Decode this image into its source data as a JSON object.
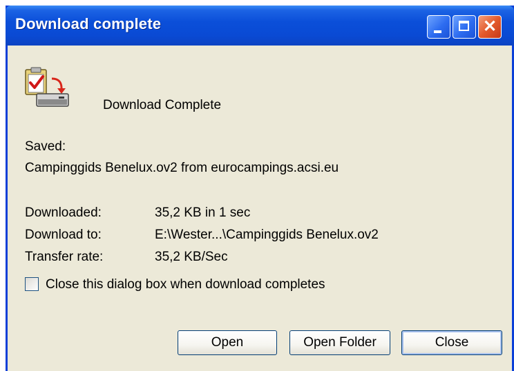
{
  "window": {
    "title": "Download complete",
    "controls": {
      "minimize": "minimize",
      "maximize": "maximize",
      "close": "close"
    }
  },
  "dialog": {
    "heading": "Download Complete",
    "saved_label": "Saved:",
    "saved_value": "Campinggids Benelux.ov2 from eurocampings.acsi.eu",
    "details": {
      "downloaded_label": "Downloaded:",
      "downloaded_value": "35,2 KB in 1 sec",
      "download_to_label": "Download to:",
      "download_to_value": "E:\\Wester...\\Campinggids Benelux.ov2",
      "transfer_rate_label": "Transfer rate:",
      "transfer_rate_value": "35,2 KB/Sec"
    },
    "checkbox": {
      "label": "Close this dialog box when download completes",
      "checked": false
    },
    "buttons": {
      "open": "Open",
      "open_folder": "Open Folder",
      "close": "Close"
    }
  },
  "icons": {
    "download": "download-complete-icon"
  },
  "colors": {
    "titlebar": "#0a4ad4",
    "client": "#ece9d8",
    "close_button": "#e35a2c"
  }
}
